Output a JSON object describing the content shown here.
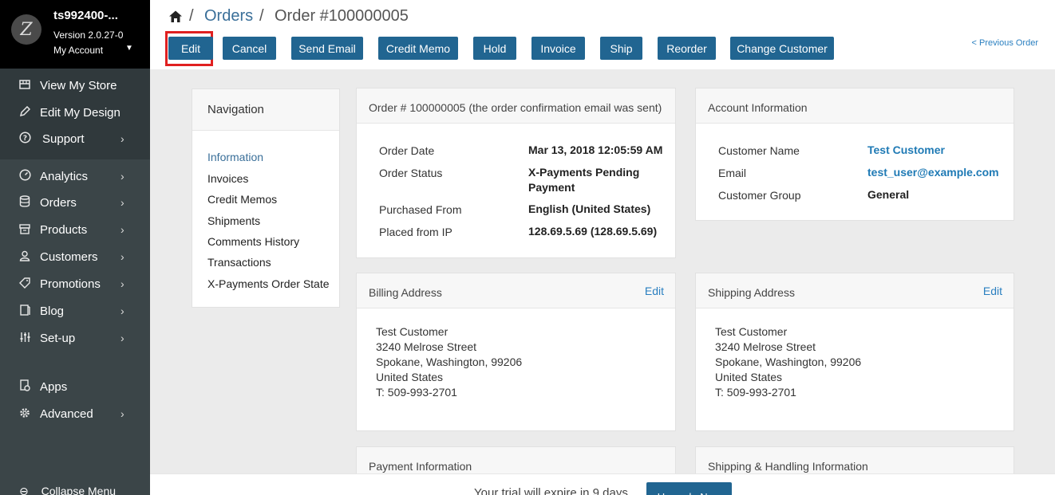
{
  "sidebar": {
    "store_name": "ts992400-...",
    "version": "Version 2.0.27-0",
    "account_label": "My Account",
    "group1": [
      {
        "label": "View My Store",
        "icon": "storefront-icon"
      },
      {
        "label": "Edit My Design",
        "icon": "pencil-icon"
      },
      {
        "label": "Support",
        "icon": "question-icon"
      }
    ],
    "group2": [
      {
        "label": "Analytics",
        "icon": "gauge-icon"
      },
      {
        "label": "Orders",
        "icon": "database-icon"
      },
      {
        "label": "Products",
        "icon": "box-icon"
      },
      {
        "label": "Customers",
        "icon": "user-icon"
      },
      {
        "label": "Promotions",
        "icon": "tag-icon"
      },
      {
        "label": "Blog",
        "icon": "book-icon"
      },
      {
        "label": "Set-up",
        "icon": "sliders-icon"
      }
    ],
    "group3": [
      {
        "label": "Apps",
        "icon": "apps-icon"
      },
      {
        "label": "Advanced",
        "icon": "gear-icon"
      }
    ],
    "collapse_label": "Collapse Menu"
  },
  "header": {
    "breadcrumb_orders": "Orders",
    "breadcrumb_current": "Order #100000005",
    "buttons": {
      "edit": "Edit",
      "cancel": "Cancel",
      "send_email": "Send Email",
      "credit_memo": "Credit Memo",
      "hold": "Hold",
      "invoice": "Invoice",
      "ship": "Ship",
      "reorder": "Reorder",
      "change_customer": "Change Customer"
    },
    "previous_order": "< Previous Order"
  },
  "navigation": {
    "title": "Navigation",
    "links": [
      "Information",
      "Invoices",
      "Credit Memos",
      "Shipments",
      "Comments History",
      "Transactions",
      "X-Payments Order State"
    ]
  },
  "order": {
    "title": "Order # 100000005 (the order confirmation email was sent)",
    "rows": [
      {
        "label": "Order Date",
        "value": "Mar 13, 2018 12:05:59 AM"
      },
      {
        "label": "Order Status",
        "value": "X-Payments Pending Payment"
      },
      {
        "label": "Purchased From",
        "value": "English (United States)"
      },
      {
        "label": "Placed from IP",
        "value": "128.69.5.69 (128.69.5.69)"
      }
    ]
  },
  "account": {
    "title": "Account Information",
    "rows": [
      {
        "label": "Customer Name",
        "value": "Test Customer"
      },
      {
        "label": "Email",
        "value": "test_user@example.com"
      },
      {
        "label": "Customer Group",
        "value": "General"
      }
    ]
  },
  "billing": {
    "title": "Billing Address",
    "edit": "Edit",
    "lines": [
      "Test Customer",
      "3240 Melrose Street",
      "Spokane, Washington, 99206",
      "United States",
      "T: 509-993-2701"
    ]
  },
  "shipping": {
    "title": "Shipping Address",
    "edit": "Edit",
    "lines": [
      "Test Customer",
      "3240 Melrose Street",
      "Spokane, Washington, 99206",
      "United States",
      "T: 509-993-2701"
    ]
  },
  "payment": {
    "title": "Payment Information"
  },
  "shipping_handling": {
    "title": "Shipping & Handling Information"
  },
  "trial": {
    "text": "Your trial will expire in 9 days",
    "upgrade": "Upgrade Now"
  }
}
